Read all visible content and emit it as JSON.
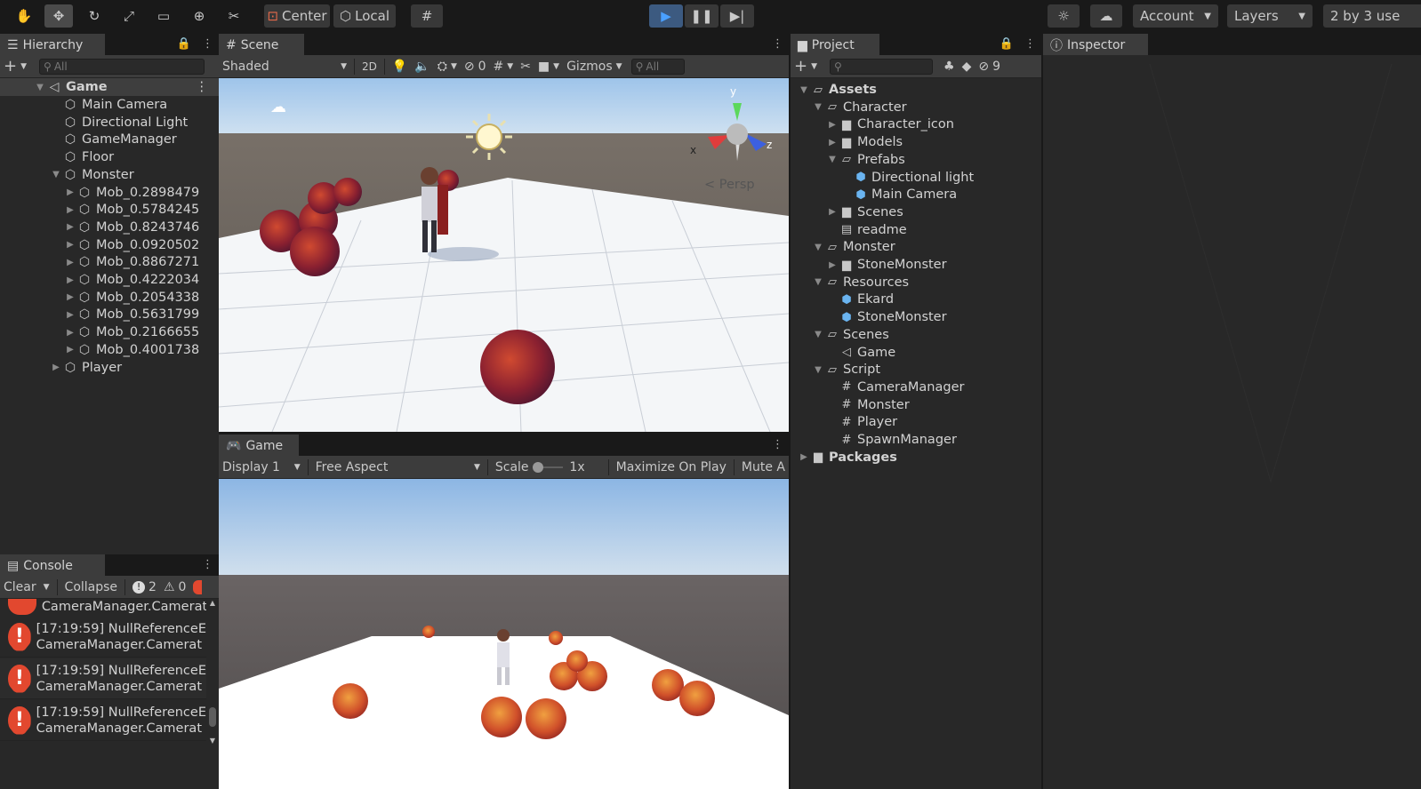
{
  "toolbar": {
    "pivot_center": "Center",
    "pivot_local": "Local",
    "account": "Account",
    "layers": "Layers",
    "layout": "2 by 3 use"
  },
  "hierarchy": {
    "tab": "Hierarchy",
    "search": "All",
    "scene": "Game",
    "items": [
      "Main Camera",
      "Directional Light",
      "GameManager",
      "Floor",
      "Monster"
    ],
    "mobs": [
      "Mob_0.2898479",
      "Mob_0.5784245",
      "Mob_0.8243746",
      "Mob_0.0920502",
      "Mob_0.8867271",
      "Mob_0.4222034",
      "Mob_0.2054338",
      "Mob_0.5631799",
      "Mob_0.2166655",
      "Mob_0.4001738"
    ],
    "player": "Player"
  },
  "scene": {
    "tab": "Scene",
    "shading": "Shaded",
    "mode2d": "2D",
    "hidden_count": "0",
    "gizmos": "Gizmos",
    "search": "All",
    "persp": "Persp",
    "axis_x": "x",
    "axis_y": "y",
    "axis_z": "z"
  },
  "game": {
    "tab": "Game",
    "display": "Display 1",
    "aspect": "Free Aspect",
    "scale_label": "Scale",
    "scale_value": "1x",
    "maximize": "Maximize On Play",
    "mute": "Mute A"
  },
  "console": {
    "tab": "Console",
    "clear": "Clear",
    "collapse": "Collapse",
    "error_count": "2",
    "warn_count": "0",
    "partial_line": "CameraManager.Camerat",
    "entries": [
      {
        "line1": "[17:19:59] NullReferenceE",
        "line2": "CameraManager.Camerat"
      },
      {
        "line1": "[17:19:59] NullReferenceE",
        "line2": "CameraManager.Camerat"
      },
      {
        "line1": "[17:19:59] NullReferenceE",
        "line2": "CameraManager.Camerat"
      }
    ]
  },
  "project": {
    "tab": "Project",
    "hidden_count": "9",
    "assets": "Assets",
    "character": "Character",
    "character_icon": "Character_icon",
    "models": "Models",
    "prefabs": "Prefabs",
    "directional_light": "Directional light",
    "main_camera": "Main Camera",
    "scenes_sub": "Scenes",
    "readme": "readme",
    "monster": "Monster",
    "stone_monster_folder": "StoneMonster",
    "resources": "Resources",
    "ekard": "Ekard",
    "stone_monster": "StoneMonster",
    "scenes": "Scenes",
    "game_scene": "Game",
    "script": "Script",
    "scripts": [
      "CameraManager",
      "Monster",
      "Player",
      "SpawnManager"
    ],
    "packages": "Packages"
  },
  "inspector": {
    "tab": "Inspector"
  }
}
